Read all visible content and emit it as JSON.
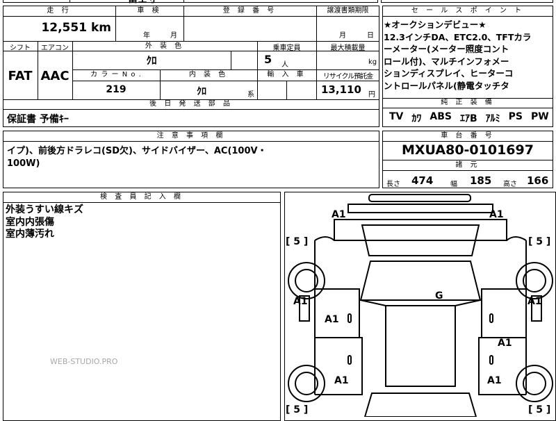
{
  "top_partial": "富士寸",
  "mileage": {
    "label": "走 行",
    "value": "12,551",
    "unit": "km"
  },
  "inspection": {
    "label": "車 検",
    "year_unit": "年",
    "month_unit": "月"
  },
  "registration": {
    "label": "登 録 番 号",
    "value": ""
  },
  "transfer_deadline": {
    "label": "譲渡書類期限",
    "month_unit": "月",
    "day_unit": "日"
  },
  "shift": {
    "label": "シフト",
    "value": "FAT"
  },
  "aircon": {
    "label": "エアコン",
    "value": "AAC"
  },
  "exterior_color": {
    "label": "外 装 色",
    "value": "ｸﾛ"
  },
  "capacity": {
    "label": "乗車定員",
    "value": "5",
    "unit": "人"
  },
  "max_load": {
    "label": "最大積載量",
    "unit": "kg"
  },
  "color_no": {
    "label": "カ ラ ー N o .",
    "value": "219"
  },
  "interior_color": {
    "label": "内 装 色",
    "value": "ｸﾛ",
    "suffix": "系"
  },
  "import": {
    "label": "輸 入 車"
  },
  "recycle": {
    "label": "リサイクル預託金",
    "value": "13,110",
    "unit": "円"
  },
  "later_parts": {
    "label": "後 日 発 送 部 品",
    "value": "保証書 予備ｷｰ"
  },
  "sales_points": {
    "label": "セ ー ル ス ポ イ ン ト",
    "lines": [
      "★オークションデビュー★",
      "12.3インチDA、ETC2.0、TFTカラ",
      "ーメーター(メーター照度コント",
      "ロール付)、マルチインフォメー",
      "ションディスプレイ、ヒーターコ",
      "ントロールパネル(静電タッチタ"
    ]
  },
  "genuine_equipment": {
    "label": "純 正 装 備",
    "items": [
      "TV",
      "ｶﾜ",
      "ABS",
      "ｴｱB",
      "ｱﾙﾐ",
      "PS",
      "PW"
    ]
  },
  "notes": {
    "label": "注 意 事 項 欄",
    "lines": [
      "イプ)、前後方ドラレコ(SD欠)、サイドバイザー、AC(100V・",
      "100W)"
    ]
  },
  "chassis": {
    "label": "車 台 番 号",
    "value": "MXUA80-0101697"
  },
  "dimensions": {
    "label": "諸 元",
    "length_label": "長さ",
    "length": "474",
    "width_label": "幅",
    "width": "185",
    "height_label": "高さ",
    "height": "166"
  },
  "inspector": {
    "label": "検 査 員 記 入 欄",
    "lines": [
      "外装うすい線キズ",
      "室内内張傷",
      "室内薄汚れ"
    ]
  },
  "watermark": "WEB-STUDIO.PRO",
  "damage_marks": {
    "front_left": "A1",
    "front_right": "A1",
    "left_front_fender": "A1",
    "right_front_fender": "A1",
    "left_door": "A1",
    "right_door": "A1",
    "left_rear": "A1",
    "right_rear": "A1",
    "glass": "G",
    "tire_fl": "[ 5 ]",
    "tire_fr": "[ 5 ]",
    "tire_rl": "[ 5 ]",
    "tire_rr": "[ 5 ]"
  }
}
